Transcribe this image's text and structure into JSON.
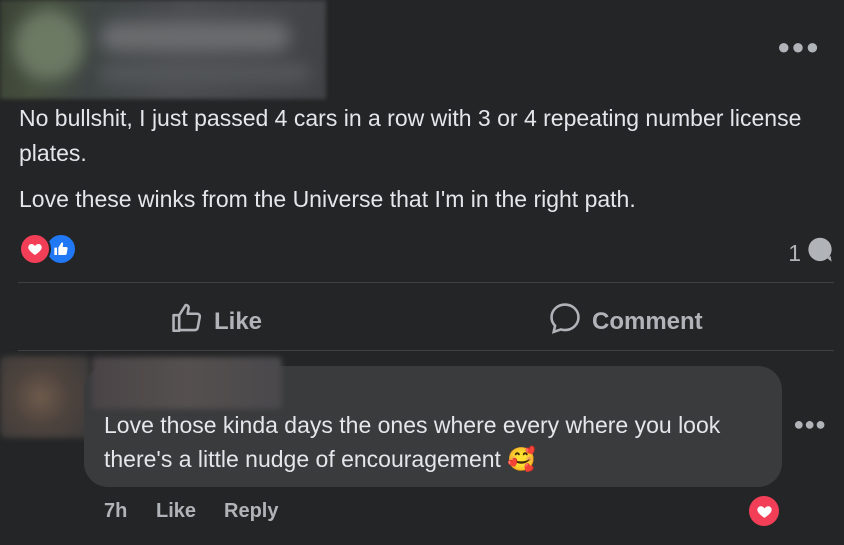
{
  "post": {
    "text": [
      "No bullshit, I just passed 4 cars in a row with 3 or 4 repeating number license plates.",
      "Love these winks from the Universe that I'm in the right path."
    ],
    "more_icon": "more-options-icon",
    "comment_count": "1"
  },
  "actions": {
    "like_label": "Like",
    "comment_label": "Comment"
  },
  "comment": {
    "text": "Love those kinda days the ones where every where you look there's a little nudge of encouragement",
    "emoji": "🥰",
    "time": "7h",
    "like_label": "Like",
    "reply_label": "Reply"
  },
  "colors": {
    "background": "#242526",
    "bubble": "#3a3b3c",
    "love": "#f33e58",
    "like": "#2078f4",
    "text": "#e4e6eb",
    "secondary_text": "#b0b3b8"
  }
}
